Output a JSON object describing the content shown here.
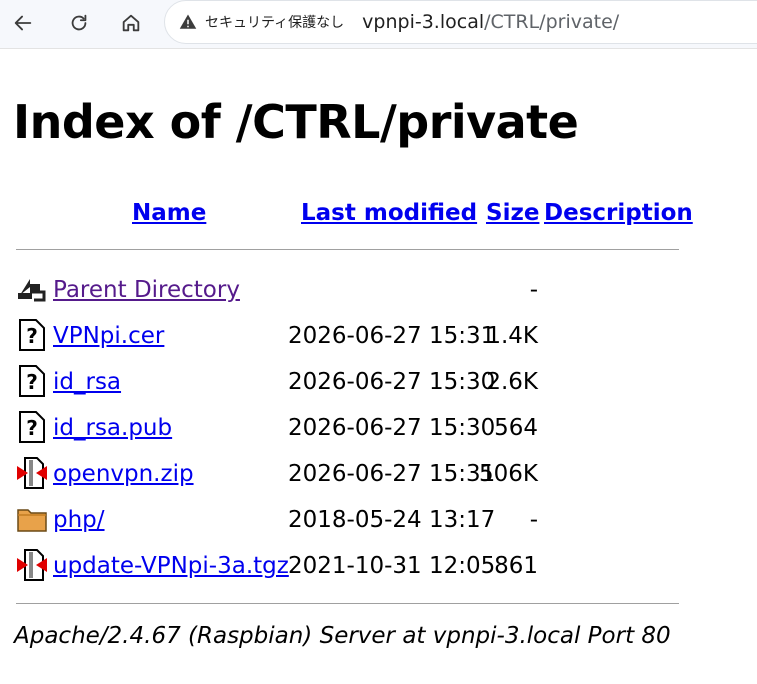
{
  "browser": {
    "security_label": "セキュリティ保護なし",
    "url_host": "vpnpi-3.local",
    "url_path": "/CTRL/private/"
  },
  "page": {
    "title": "Index of /CTRL/private",
    "columns": {
      "name": "Name",
      "last_modified": "Last modified",
      "size": "Size",
      "description": "Description"
    },
    "rows": [
      {
        "name": "Parent Directory",
        "date": "",
        "size": "-",
        "icon": "back-icon"
      },
      {
        "name": "VPNpi.cer",
        "date": "2026-06-27 15:31",
        "size": "1.4K",
        "icon": "unknown-file-icon"
      },
      {
        "name": "id_rsa",
        "date": "2026-06-27 15:30",
        "size": "2.6K",
        "icon": "unknown-file-icon"
      },
      {
        "name": "id_rsa.pub",
        "date": "2026-06-27 15:30",
        "size": "564",
        "icon": "unknown-file-icon"
      },
      {
        "name": "openvpn.zip",
        "date": "2026-06-27 15:31",
        "size": "506K",
        "icon": "compressed-file-icon"
      },
      {
        "name": "php/",
        "date": "2018-05-24 13:17",
        "size": "-",
        "icon": "folder-icon"
      },
      {
        "name": "update-VPNpi-3a.tgz",
        "date": "2021-10-31 12:05",
        "size": "861",
        "icon": "compressed-file-icon"
      }
    ],
    "footer": "Apache/2.4.67 (Raspbian) Server at vpnpi-3.local Port 80"
  }
}
